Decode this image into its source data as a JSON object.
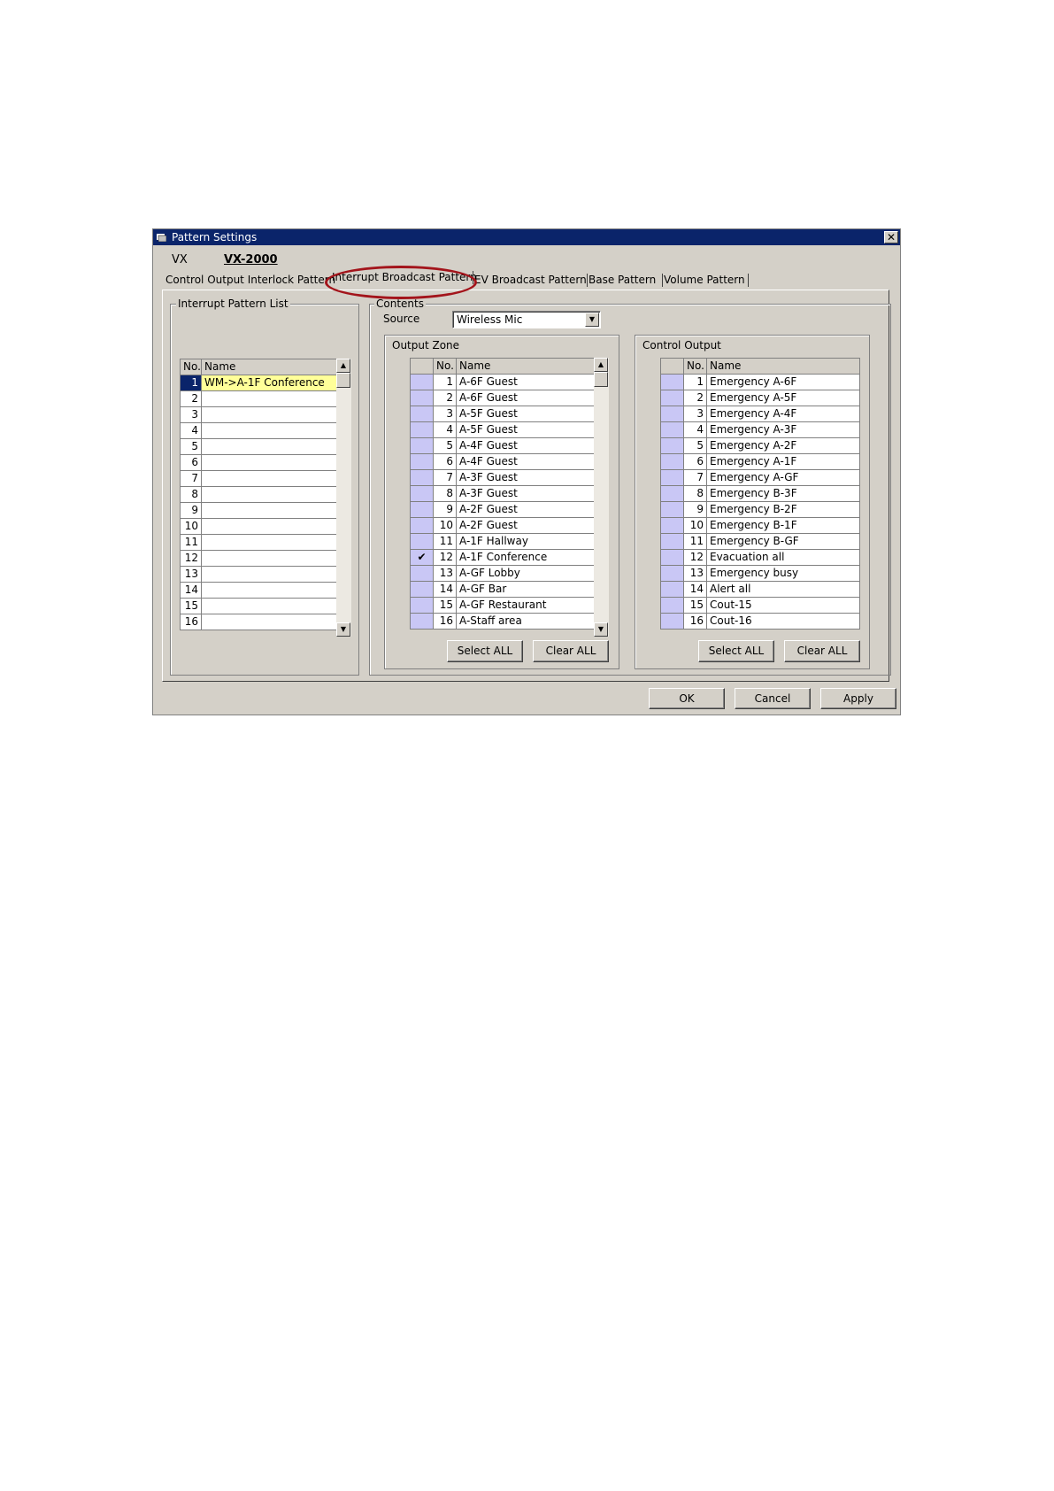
{
  "window": {
    "title": "Pattern Settings",
    "close": "✕"
  },
  "device": {
    "label": "VX",
    "model": "VX-2000"
  },
  "tabs": [
    {
      "label": "Control Output Interlock Pattern"
    },
    {
      "label": "Interrupt Broadcast Pattern",
      "active": true
    },
    {
      "label": "EV Broadcast Pattern"
    },
    {
      "label": "Base Pattern"
    },
    {
      "label": "Volume Pattern"
    }
  ],
  "pattern_list": {
    "title": "Interrupt Pattern List",
    "header_no": "No.",
    "header_name": "Name",
    "rows": [
      {
        "no": "1",
        "name": "WM->A-1F Conference",
        "selected": true
      },
      {
        "no": "2",
        "name": ""
      },
      {
        "no": "3",
        "name": ""
      },
      {
        "no": "4",
        "name": ""
      },
      {
        "no": "5",
        "name": ""
      },
      {
        "no": "6",
        "name": ""
      },
      {
        "no": "7",
        "name": ""
      },
      {
        "no": "8",
        "name": ""
      },
      {
        "no": "9",
        "name": ""
      },
      {
        "no": "10",
        "name": ""
      },
      {
        "no": "11",
        "name": ""
      },
      {
        "no": "12",
        "name": ""
      },
      {
        "no": "13",
        "name": ""
      },
      {
        "no": "14",
        "name": ""
      },
      {
        "no": "15",
        "name": ""
      },
      {
        "no": "16",
        "name": ""
      }
    ]
  },
  "contents": {
    "title": "Contents",
    "source_label": "Source",
    "source_value": "Wireless Mic"
  },
  "output_zone": {
    "title": "Output Zone",
    "header_no": "No.",
    "header_name": "Name",
    "rows": [
      {
        "check": "",
        "no": "1",
        "name": "A-6F Guest"
      },
      {
        "check": "",
        "no": "2",
        "name": "A-6F Guest"
      },
      {
        "check": "",
        "no": "3",
        "name": "A-5F Guest"
      },
      {
        "check": "",
        "no": "4",
        "name": "A-5F Guest"
      },
      {
        "check": "",
        "no": "5",
        "name": "A-4F Guest"
      },
      {
        "check": "",
        "no": "6",
        "name": "A-4F Guest"
      },
      {
        "check": "",
        "no": "7",
        "name": "A-3F Guest"
      },
      {
        "check": "",
        "no": "8",
        "name": "A-3F Guest"
      },
      {
        "check": "",
        "no": "9",
        "name": "A-2F Guest"
      },
      {
        "check": "",
        "no": "10",
        "name": "A-2F Guest"
      },
      {
        "check": "",
        "no": "11",
        "name": "A-1F Hallway"
      },
      {
        "check": "✔",
        "no": "12",
        "name": "A-1F Conference"
      },
      {
        "check": "",
        "no": "13",
        "name": "A-GF Lobby"
      },
      {
        "check": "",
        "no": "14",
        "name": "A-GF Bar"
      },
      {
        "check": "",
        "no": "15",
        "name": "A-GF Restaurant"
      },
      {
        "check": "",
        "no": "16",
        "name": "A-Staff area"
      }
    ],
    "select_all": "Select ALL",
    "clear_all": "Clear ALL"
  },
  "control_output": {
    "title": "Control Output",
    "header_no": "No.",
    "header_name": "Name",
    "rows": [
      {
        "check": "",
        "no": "1",
        "name": "Emergency A-6F"
      },
      {
        "check": "",
        "no": "2",
        "name": "Emergency A-5F"
      },
      {
        "check": "",
        "no": "3",
        "name": "Emergency A-4F"
      },
      {
        "check": "",
        "no": "4",
        "name": "Emergency A-3F"
      },
      {
        "check": "",
        "no": "5",
        "name": "Emergency A-2F"
      },
      {
        "check": "",
        "no": "6",
        "name": "Emergency A-1F"
      },
      {
        "check": "",
        "no": "7",
        "name": "Emergency A-GF"
      },
      {
        "check": "",
        "no": "8",
        "name": "Emergency B-3F"
      },
      {
        "check": "",
        "no": "9",
        "name": "Emergency B-2F"
      },
      {
        "check": "",
        "no": "10",
        "name": "Emergency B-1F"
      },
      {
        "check": "",
        "no": "11",
        "name": "Emergency B-GF"
      },
      {
        "check": "",
        "no": "12",
        "name": "Evacuation all"
      },
      {
        "check": "",
        "no": "13",
        "name": "Emergency busy"
      },
      {
        "check": "",
        "no": "14",
        "name": "Alert all"
      },
      {
        "check": "",
        "no": "15",
        "name": "Cout-15"
      },
      {
        "check": "",
        "no": "16",
        "name": "Cout-16"
      }
    ],
    "select_all": "Select ALL",
    "clear_all": "Clear ALL"
  },
  "footer": {
    "ok": "OK",
    "cancel": "Cancel",
    "apply": "Apply"
  },
  "icons": {
    "scroll_up": "▲",
    "scroll_down": "▼",
    "dropdown": "▼"
  },
  "colors": {
    "titlebar": "#0a246a",
    "check_cell": "#c9c7f5",
    "selected_name": "#ffff99",
    "highlight_ring": "#a3141b"
  }
}
